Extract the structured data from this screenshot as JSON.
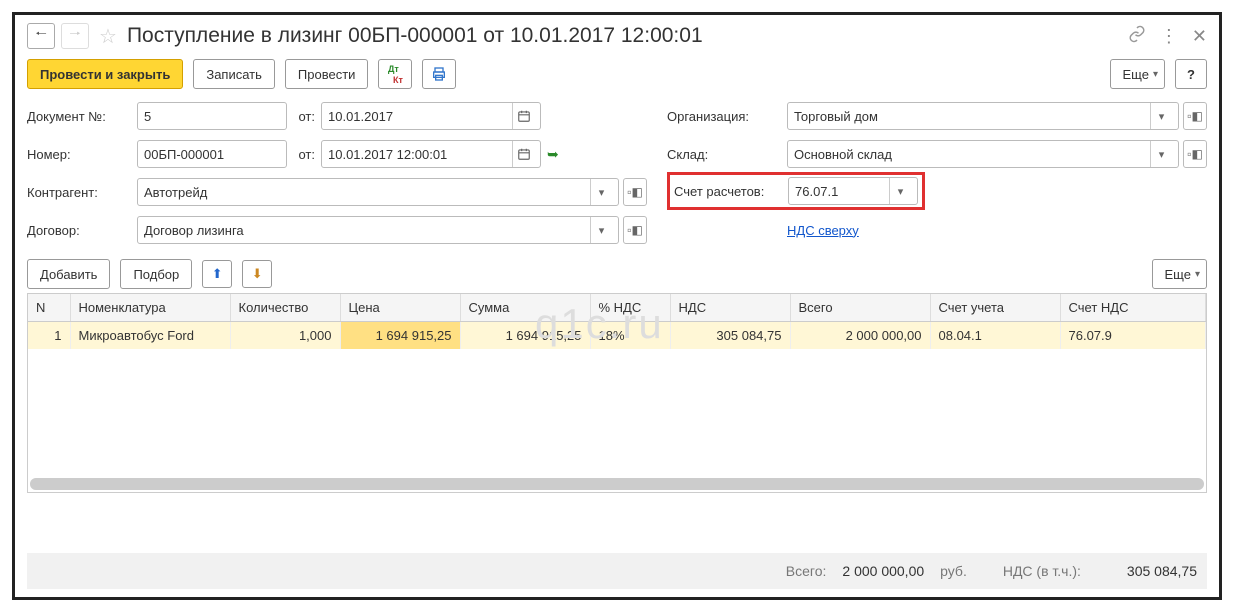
{
  "title": "Поступление в лизинг 00БП-000001 от 10.01.2017 12:00:01",
  "toolbar": {
    "submit_close": "Провести и закрыть",
    "save": "Записать",
    "submit": "Провести",
    "more": "Еще",
    "help": "?"
  },
  "form": {
    "doc_no_label": "Документ №:",
    "doc_no": "5",
    "date_from_label": "от:",
    "doc_date": "10.01.2017",
    "number_label": "Номер:",
    "number": "00БП-000001",
    "number_date": "10.01.2017 12:00:01",
    "counterparty_label": "Контрагент:",
    "counterparty": "Автотрейд",
    "contract_label": "Договор:",
    "contract": "Договор лизинга",
    "org_label": "Организация:",
    "org": "Торговый дом",
    "warehouse_label": "Склад:",
    "warehouse": "Основной склад",
    "account_label": "Счет расчетов:",
    "account": "76.07.1",
    "vat_link": "НДС сверху"
  },
  "table_toolbar": {
    "add": "Добавить",
    "pick": "Подбор",
    "more": "Еще"
  },
  "table": {
    "headers": {
      "n": "N",
      "nomenclature": "Номенклатура",
      "qty": "Количество",
      "price": "Цена",
      "sum": "Сумма",
      "vat_pct": "% НДС",
      "vat": "НДС",
      "total": "Всего",
      "acct": "Счет учета",
      "vat_acct": "Счет НДС"
    },
    "rows": [
      {
        "n": "1",
        "nomenclature": "Микроавтобус Ford",
        "qty": "1,000",
        "price": "1 694 915,25",
        "sum": "1 694 915,25",
        "vat_pct": "18%",
        "vat": "305 084,75",
        "total": "2 000 000,00",
        "acct": "08.04.1",
        "vat_acct": "76.07.9"
      }
    ]
  },
  "footer": {
    "total_label": "Всего:",
    "total": "2 000 000,00",
    "currency": "руб.",
    "vat_label": "НДС (в т.ч.):",
    "vat": "305 084,75"
  },
  "watermark": "q1c.ru"
}
